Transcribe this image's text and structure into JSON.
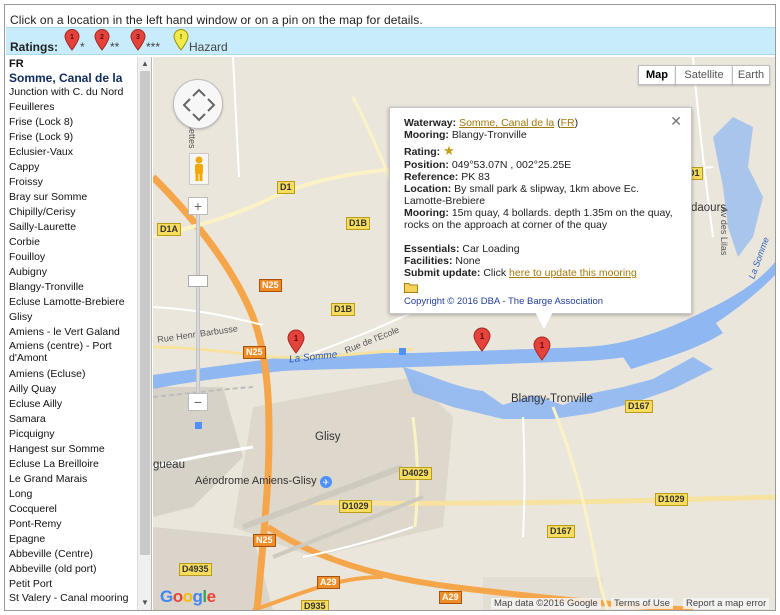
{
  "instructions": "Click on a location in the left hand window or on a pin on the map for details.",
  "ratings": {
    "label": "Ratings:",
    "items": [
      {
        "label": "*",
        "color": "#e5423c",
        "pin_number": "1"
      },
      {
        "label": "**",
        "color": "#e5423c",
        "pin_number": "2"
      },
      {
        "label": "***",
        "color": "#e5423c",
        "pin_number": "3"
      },
      {
        "label": "Hazard",
        "color": "#f2e94b",
        "pin_number": "!"
      }
    ]
  },
  "sidebar": {
    "country": "FR",
    "waterway": "Somme, Canal de la",
    "locations": [
      "Junction with C. du Nord",
      "Feuilleres",
      "Frise (Lock 8)",
      "Frise (Lock 9)",
      "Eclusier-Vaux",
      "Cappy",
      "Froissy",
      "Bray sur Somme",
      "Chipilly/Cerisy",
      "Sailly-Laurette",
      "Corbie",
      "Fouilloy",
      "Aubigny",
      "Blangy-Tronville",
      "Ecluse Lamotte-Brebiere",
      "Glisy",
      "Amiens - le Vert Galand",
      "Amiens (centre) - Port d'Amont",
      "Amiens (Ecluse)",
      "Ailly Quay",
      "Ecluse Ailly",
      "Samara",
      "Picquigny",
      "Hangest sur Somme",
      "Ecluse La Breilloire",
      "Le Grand Marais",
      "Long",
      "Cocquerel",
      "Pont-Remy",
      "Epagne",
      "Abbeville (Centre)",
      "Abbeville (old port)",
      "Petit Port",
      "St Valery - Canal mooring"
    ],
    "scroll_up": "▲",
    "scroll_down": "▼"
  },
  "map": {
    "type_buttons": [
      "Map",
      "Satellite",
      "Earth"
    ],
    "active_type": "Map",
    "zoom_in": "+",
    "zoom_out": "−",
    "roads": [
      "D1",
      "D1A",
      "D1B",
      "D1B",
      "N25",
      "N25",
      "D167",
      "D4029",
      "D1029",
      "D1029",
      "D167",
      "N25",
      "D4935",
      "A29",
      "A29",
      "D935",
      "D1"
    ],
    "places": [
      "Blangy-Tronville",
      "Glisy",
      "Aérodrome Amiens-Glisy",
      "gueau",
      "daours"
    ],
    "streets": [
      "Rue Henri Barbusse",
      "La Somme",
      "Rue de l'Ecole",
      "des Croisettes",
      "Av des Lilas",
      "La Somme"
    ],
    "google_logo": "Google",
    "attribution": [
      "Map data ©2016 Google",
      "Terms of Use",
      "Report a map error"
    ],
    "colors": {
      "water": "#8fb7f1",
      "highway": "#f6a64a",
      "road": "#ffffff",
      "marker": "#e5423c"
    }
  },
  "infowindow": {
    "waterway_label": "Waterway:",
    "waterway_value": "Somme, Canal de la",
    "country_value": "FR",
    "mooring_label": "Mooring:",
    "mooring_value": "Blangy-Tronville",
    "rating_label": "Rating:",
    "rating_stars": 1,
    "position_label": "Position:",
    "position_value": "049°53.07N , 002°25.25E",
    "reference_label": "Reference:",
    "reference_value": "PK 83",
    "location_label": "Location:",
    "location_value": "By small park & slipway, 1km above Ec. Lamotte-Brebiere",
    "mooring_detail_label": "Mooring:",
    "mooring_detail_value": "15m quay, 4 bollards. depth 1.35m on the quay, rocks on the approach at corner of the quay",
    "essentials_label": "Essentials:",
    "essentials_value": "Car Loading",
    "facilities_label": "Facilities:",
    "facilities_value": "None",
    "submit_label": "Submit update:",
    "submit_prefix": "Click",
    "submit_link": "here to update this mooring",
    "copyright": "Copyright © 2016 DBA - The Barge Association",
    "close": "✕"
  }
}
